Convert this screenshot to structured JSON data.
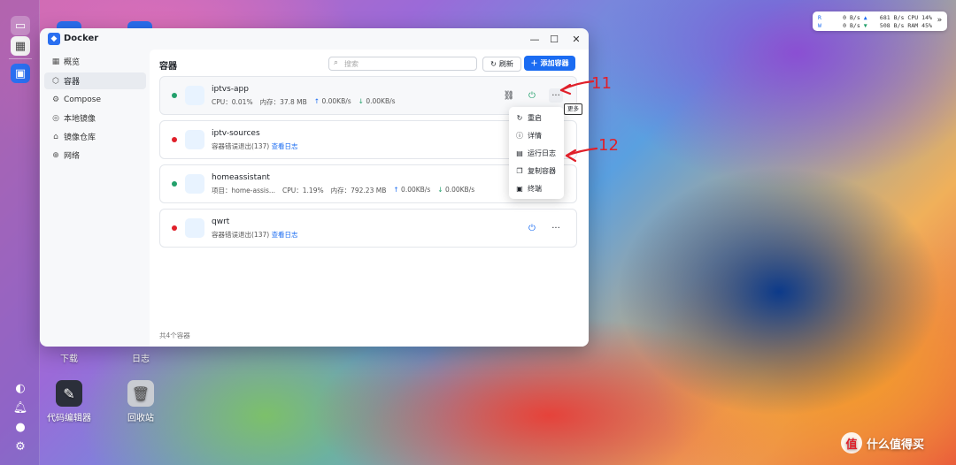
{
  "app": {
    "title": "Docker"
  },
  "sidebar": {
    "items": [
      {
        "label": "概览",
        "icon": "grid-icon"
      },
      {
        "label": "容器",
        "icon": "cube-icon",
        "active": true
      },
      {
        "label": "Compose",
        "icon": "settings-icon"
      },
      {
        "label": "本地镜像",
        "icon": "disk-icon"
      },
      {
        "label": "镜像仓库",
        "icon": "home-icon"
      },
      {
        "label": "网络",
        "icon": "globe-icon"
      }
    ]
  },
  "main": {
    "title": "容器",
    "search_placeholder": "搜索",
    "refresh_label": "刷新",
    "add_label": "添加容器",
    "footer": "共4个容器"
  },
  "containers": [
    {
      "name": "iptvs-app",
      "status": "running",
      "cpu": "CPU：0.01%",
      "mem": "内存：37.8 MB",
      "up": "0.00KB/s",
      "down": "0.00KB/s"
    },
    {
      "name": "iptv-sources",
      "status": "stopped",
      "error": "容器错误退出(137)",
      "link": "查看日志"
    },
    {
      "name": "homeassistant",
      "status": "running",
      "project": "项目：home-assis...",
      "cpu": "CPU：1.19%",
      "mem": "内存：792.23 MB",
      "up": "0.00KB/s",
      "down": "0.00KB/s"
    },
    {
      "name": "qwrt",
      "status": "stopped",
      "error": "容器错误退出(137)",
      "link": "查看日志"
    }
  ],
  "tooltip": "更多",
  "context_menu": [
    {
      "label": "重启",
      "icon": "restart-icon"
    },
    {
      "label": "详情",
      "icon": "info-icon"
    },
    {
      "label": "运行日志",
      "icon": "document-icon"
    },
    {
      "label": "复制容器",
      "icon": "copy-icon"
    },
    {
      "label": "终端",
      "icon": "terminal-icon"
    }
  ],
  "annotations": {
    "a1": "11",
    "a2": "12"
  },
  "desktop_icons": [
    {
      "label": "下载"
    },
    {
      "label": "日志"
    },
    {
      "label": "代码编辑器"
    },
    {
      "label": "回收站"
    }
  ],
  "netmon": {
    "r_label": "R",
    "r_val": "0",
    "r_unit": "B/s",
    "r2_val": "681",
    "r2_unit": "B/s",
    "cpu_label": "CPU",
    "cpu_val": "14%",
    "w_label": "W",
    "w_val": "0",
    "w_unit": "B/s",
    "w2_val": "508",
    "w2_unit": "B/s",
    "ram_label": "RAM",
    "ram_val": "45%"
  },
  "brand": {
    "text": "什么值得买",
    "icon_glyph": "值"
  },
  "colors": {
    "running": "#22a06b",
    "stopped": "#e0202a",
    "accent": "#1b6cf2"
  }
}
